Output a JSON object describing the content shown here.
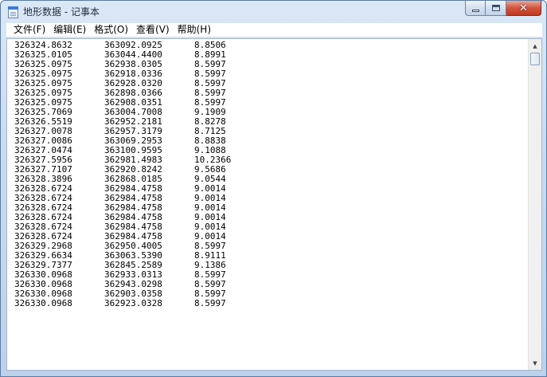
{
  "window": {
    "title": "地形数据 - 记事本",
    "close_glyph": "✕"
  },
  "menu": [
    {
      "label": "文件(F)"
    },
    {
      "label": "编辑(E)"
    },
    {
      "label": "格式(O)"
    },
    {
      "label": "查看(V)"
    },
    {
      "label": "帮助(H)"
    }
  ],
  "scrollbar": {
    "up_glyph": "▲",
    "down_glyph": "▼"
  },
  "lines": [
    [
      "326324.8632",
      "363092.0925",
      "8.8506"
    ],
    [
      "326325.0105",
      "363044.4400",
      "8.8991"
    ],
    [
      "326325.0975",
      "362938.0305",
      "8.5997"
    ],
    [
      "326325.0975",
      "362918.0336",
      "8.5997"
    ],
    [
      "326325.0975",
      "362928.0320",
      "8.5997"
    ],
    [
      "326325.0975",
      "362898.0366",
      "8.5997"
    ],
    [
      "326325.0975",
      "362908.0351",
      "8.5997"
    ],
    [
      "326325.7069",
      "363004.7008",
      "9.1909"
    ],
    [
      "326326.5519",
      "362952.2181",
      "8.8278"
    ],
    [
      "326327.0078",
      "362957.3179",
      "8.7125"
    ],
    [
      "326327.0086",
      "363069.2953",
      "8.8838"
    ],
    [
      "326327.0474",
      "363100.9595",
      "9.1088"
    ],
    [
      "326327.5956",
      "362981.4983",
      "10.2366"
    ],
    [
      "326327.7107",
      "362920.8242",
      "9.5686"
    ],
    [
      "326328.3896",
      "362868.0185",
      "9.0544"
    ],
    [
      "326328.6724",
      "362984.4758",
      "9.0014"
    ],
    [
      "326328.6724",
      "362984.4758",
      "9.0014"
    ],
    [
      "326328.6724",
      "362984.4758",
      "9.0014"
    ],
    [
      "326328.6724",
      "362984.4758",
      "9.0014"
    ],
    [
      "326328.6724",
      "362984.4758",
      "9.0014"
    ],
    [
      "326328.6724",
      "362984.4758",
      "9.0014"
    ],
    [
      "326329.2968",
      "362950.4005",
      "8.5997"
    ],
    [
      "326329.6634",
      "363063.5390",
      "8.9111"
    ],
    [
      "326329.7377",
      "362845.2589",
      "9.1386"
    ],
    [
      "326330.0968",
      "362933.0313",
      "8.5997"
    ],
    [
      "326330.0968",
      "362943.0298",
      "8.5997"
    ],
    [
      "326330.0968",
      "362903.0358",
      "8.5997"
    ],
    [
      "326330.0968",
      "362923.0328",
      "8.5997"
    ]
  ]
}
